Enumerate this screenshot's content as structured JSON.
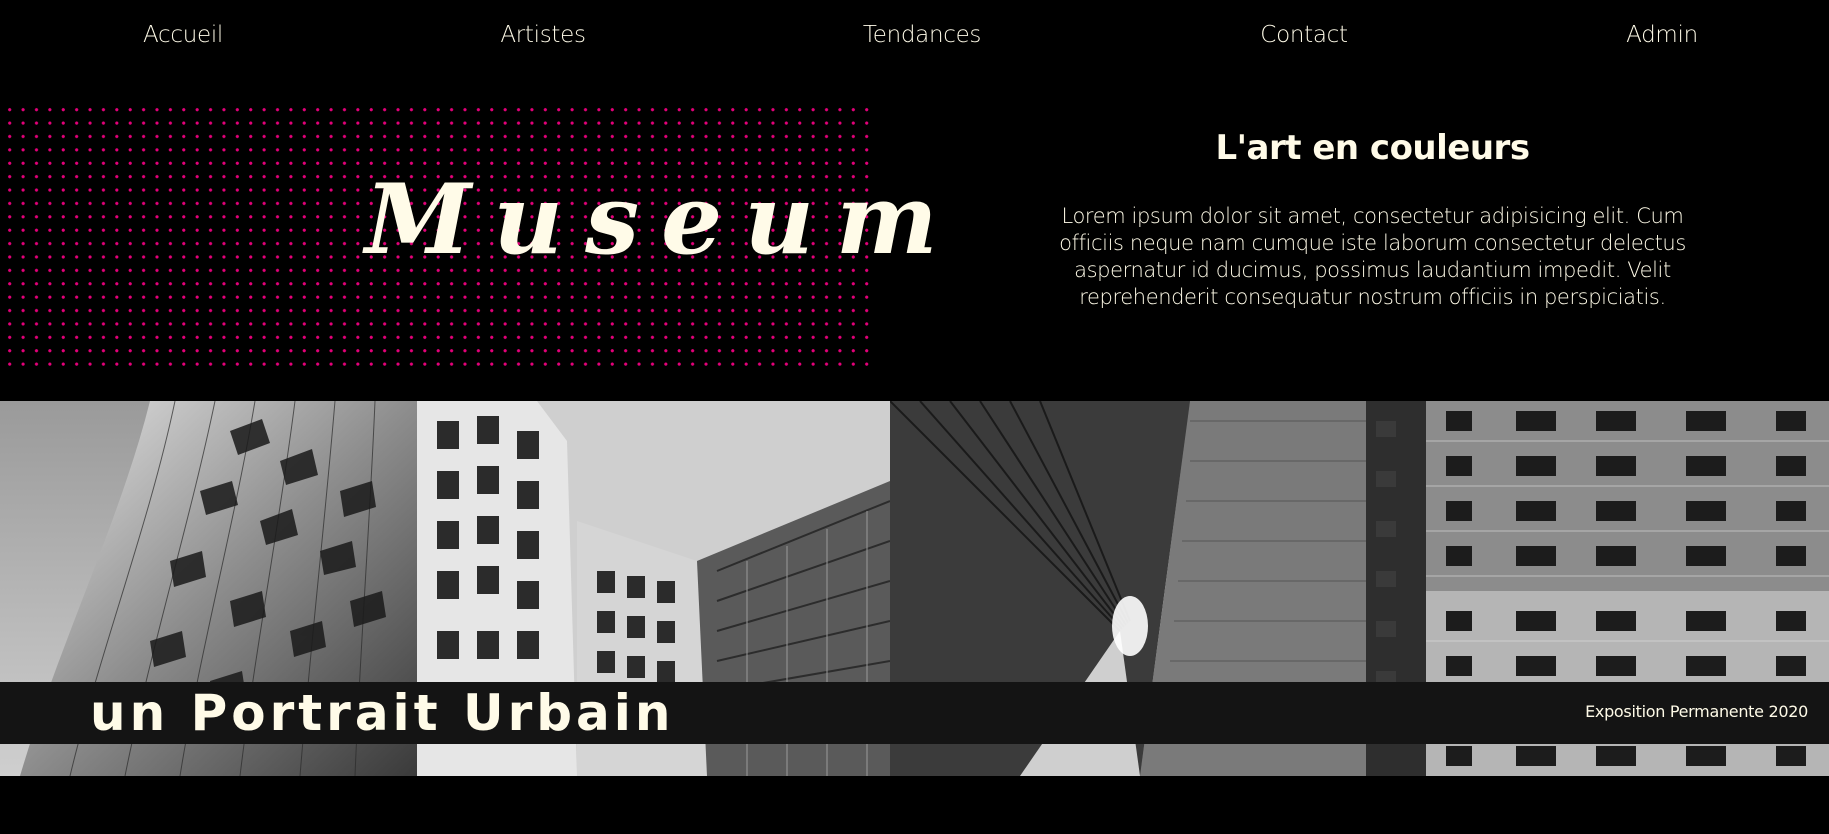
{
  "nav": {
    "items": [
      {
        "label": "Accueil"
      },
      {
        "label": "Artistes"
      },
      {
        "label": "Tendances"
      },
      {
        "label": "Contact"
      },
      {
        "label": "Admin"
      }
    ]
  },
  "hero": {
    "title": "Museum",
    "heading": "L'art en couleurs",
    "text": "Lorem ipsum dolor sit amet, consectetur adipisicing elit. Cum officiis neque nam cumque iste laborum consectetur delectus aspernatur id ducimus, possimus laudantium impedit. Velit reprehenderit consequatur nostrum officiis in perspiciatis."
  },
  "gallery": {
    "title": "un Portrait Urbain",
    "subtitle": "Exposition Permanente 2020",
    "photos": [
      {
        "name": "wavy-facade-building"
      },
      {
        "name": "modern-apartment-blocks"
      },
      {
        "name": "sloped-corridor-tunnel"
      },
      {
        "name": "residential-tower-windows"
      }
    ]
  },
  "colors": {
    "background": "#000000",
    "text": "#fffbe8",
    "dot_accent": "#e5007a",
    "caption_band": "#141414"
  }
}
